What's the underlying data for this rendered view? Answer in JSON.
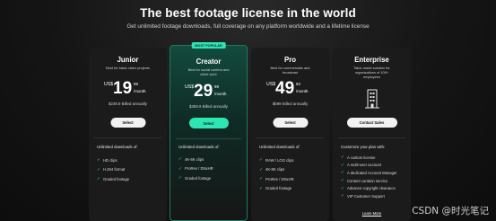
{
  "header": {
    "title": "The best footage license in the world",
    "subtitle": "Get unlimited footage downloads, full coverage on any platform worldwide and a lifetime license"
  },
  "plans": [
    {
      "name": "Junior",
      "description": "Best for basic video projects",
      "currency": "US$",
      "price_whole": "19",
      "price_cents": "99",
      "per": "/month",
      "billed": "$239.9 Billed annually",
      "button": "Select",
      "features_heading": "Unlimited downloads of:",
      "features": [
        "HD clips",
        "H.264 format",
        "Graded footage"
      ]
    },
    {
      "name": "Creator",
      "badge": "MOST POPULAR",
      "description": "Best for social content and client work",
      "currency": "US$",
      "price_whole": "29",
      "price_cents": "99",
      "per": "/month",
      "billed": "$359.9 Billed annually",
      "button": "Select",
      "features_heading": "Unlimited downloads of:",
      "features": [
        "4K-6K clips",
        "ProRes / DNxHR",
        "Graded footage"
      ]
    },
    {
      "name": "Pro",
      "description": "Best for commercials and broadcast",
      "currency": "US$",
      "price_whole": "49",
      "price_cents": "92",
      "per": "/month",
      "billed": "$599 Billed annually",
      "button": "Select",
      "features_heading": "Unlimited downloads of:",
      "features": [
        "RAW / LOG clips",
        "4K-8K clips",
        "ProRes / DNxHR",
        "Graded footage"
      ]
    },
    {
      "name": "Enterprise",
      "description": "Tailor-made solution for organizations of 100+ employees",
      "icon": "building-icon",
      "button": "Contact Sales",
      "features_heading": "Customize your plan with:",
      "features": [
        "A custom license",
        "A multi-user account",
        "A dedicated Account Manager",
        "Content curation service",
        "Advance copyright clearance",
        "VIP Customer Support"
      ],
      "link": "Learn More"
    }
  ],
  "watermark": "CSDN @时光笔记",
  "colors": {
    "accent": "#2ee6b3",
    "card_bg": "#1b1b1b",
    "featured_bg": "#134a3e"
  }
}
